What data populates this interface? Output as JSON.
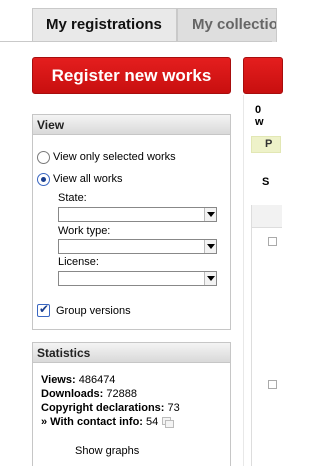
{
  "tabs": {
    "active": "My registrations",
    "inactive": "My collections"
  },
  "register_button": "Register new works",
  "view_panel": {
    "title": "View",
    "option_selected": "View only selected works",
    "option_all": "View all works",
    "state_label": "State:",
    "state_value": "",
    "work_type_label": "Work type:",
    "work_type_value": "",
    "license_label": "License:",
    "license_value": "",
    "group_versions": "Group versions"
  },
  "statistics": {
    "title": "Statistics",
    "views_label": "Views:",
    "views": "486474",
    "downloads_label": "Downloads:",
    "downloads": "72888",
    "copyright_label": "Copyright declarations:",
    "copyright": "73",
    "contact_label": "» With contact info:",
    "contact": "54",
    "show_graphs": "Show graphs"
  },
  "right": {
    "count_fragment": "0 w",
    "pill_fragment": "P",
    "s_fragment": "S"
  }
}
